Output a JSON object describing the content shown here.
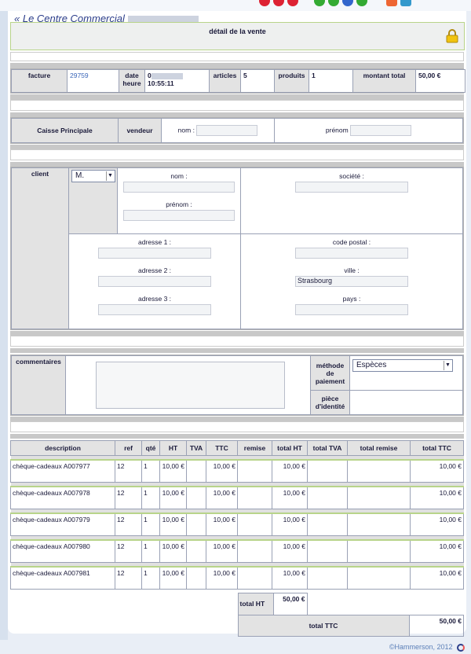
{
  "header": {
    "back_link": "« Le Centre Commercial",
    "title": "détail de la vente"
  },
  "invoice": {
    "facture_label": "facture",
    "facture_value": "29759",
    "date_label": "date heure",
    "date_value": "0",
    "time_value": "10:55:11",
    "articles_label": "articles",
    "articles_value": "5",
    "produits_label": "produits",
    "produits_value": "1",
    "montant_label": "montant total",
    "montant_value": "50,00 €"
  },
  "caisse": {
    "label": "Caisse Principale",
    "vendeur_label": "vendeur",
    "nom_label": "nom :",
    "prenom_label": "prénom"
  },
  "client": {
    "label": "client",
    "civility": "M.",
    "nom_label": "nom :",
    "prenom_label": "prénom :",
    "societe_label": "société :",
    "adresse1_label": "adresse 1 :",
    "adresse2_label": "adresse 2 :",
    "adresse3_label": "adresse 3 :",
    "code_postal_label": "code postal :",
    "ville_label": "ville :",
    "ville_value": "Strasbourg",
    "pays_label": "pays :"
  },
  "comments": {
    "label": "commentaires",
    "methode_label": "méthode de paiement",
    "methode_value": "Espèces",
    "piece_label": "pièce d'identité"
  },
  "items": {
    "headers": [
      "description",
      "ref",
      "qté",
      "HT",
      "TVA",
      "TTC",
      "remise",
      "total HT",
      "total TVA",
      "total remise",
      "total TTC"
    ],
    "rows": [
      {
        "description": "chèque-cadeaux A007977",
        "ref": "12",
        "qte": "1",
        "ht": "10,00 €",
        "tva": "",
        "ttc": "10,00 €",
        "remise": "",
        "total_ht": "10,00 €",
        "total_tva": "",
        "total_remise": "",
        "total_ttc": "10,00 €"
      },
      {
        "description": "chèque-cadeaux A007978",
        "ref": "12",
        "qte": "1",
        "ht": "10,00 €",
        "tva": "",
        "ttc": "10,00 €",
        "remise": "",
        "total_ht": "10,00 €",
        "total_tva": "",
        "total_remise": "",
        "total_ttc": "10,00 €"
      },
      {
        "description": "chèque-cadeaux A007979",
        "ref": "12",
        "qte": "1",
        "ht": "10,00 €",
        "tva": "",
        "ttc": "10,00 €",
        "remise": "",
        "total_ht": "10,00 €",
        "total_tva": "",
        "total_remise": "",
        "total_ttc": "10,00 €"
      },
      {
        "description": "chèque-cadeaux A007980",
        "ref": "12",
        "qte": "1",
        "ht": "10,00 €",
        "tva": "",
        "ttc": "10,00 €",
        "remise": "",
        "total_ht": "10,00 €",
        "total_tva": "",
        "total_remise": "",
        "total_ttc": "10,00 €"
      },
      {
        "description": "chèque-cadeaux A007981",
        "ref": "12",
        "qte": "1",
        "ht": "10,00 €",
        "tva": "",
        "ttc": "10,00 €",
        "remise": "",
        "total_ht": "10,00 €",
        "total_tva": "",
        "total_remise": "",
        "total_ttc": "10,00 €"
      }
    ],
    "total_ht_label": "total HT",
    "total_ht_value": "50,00 €",
    "total_ttc_label": "total TTC",
    "total_ttc_value": "50,00 €"
  },
  "footer": {
    "copyright": "©Hammerson, 2012"
  },
  "icons": {
    "lock": "lock-icon",
    "footer_logo": "hammerson-logo-icon"
  }
}
